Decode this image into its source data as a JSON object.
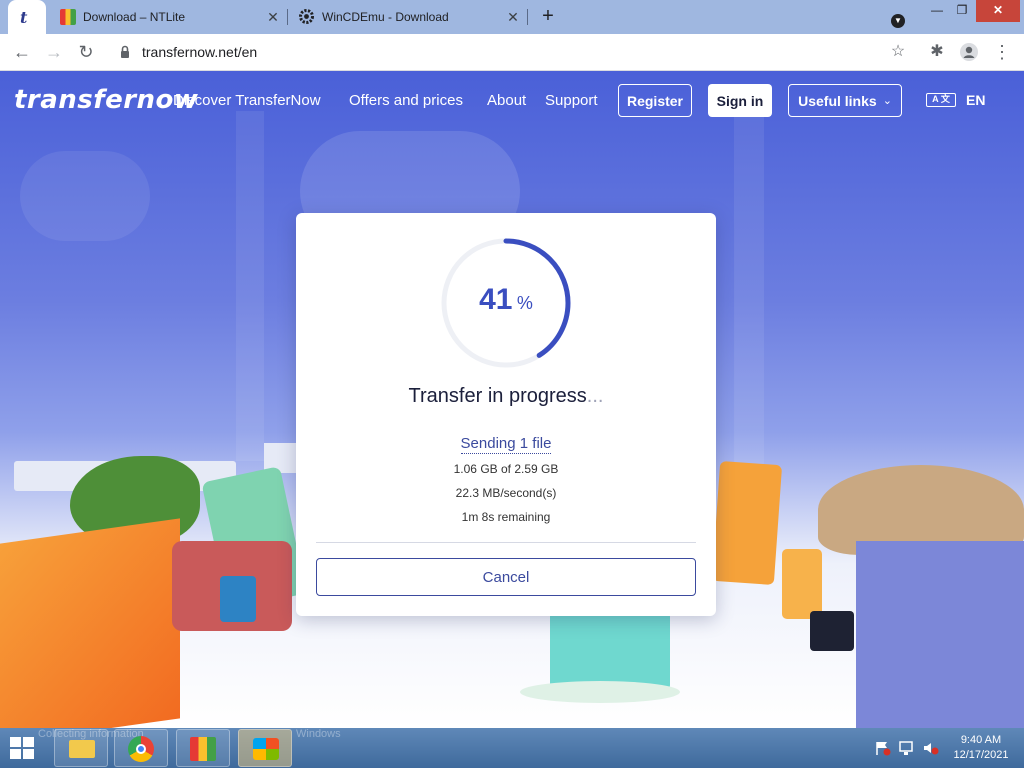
{
  "browser": {
    "tabs": [
      {
        "favicon": "tab-favicon-transfernow",
        "glyph": "t",
        "label": "",
        "active": true
      },
      {
        "favicon": "ntlite-icon",
        "label": "Download – NTLite",
        "active": false
      },
      {
        "favicon": "gear-icon",
        "label": "WinCDEmu - Download",
        "active": false
      }
    ],
    "tab_close_glyph": "✕",
    "new_tab_glyph": "+",
    "url": "transfernow.net/en",
    "window_controls": {
      "profile_glyph": "▼",
      "minimize": "—",
      "restore": "❐",
      "close": "✕"
    },
    "nav": {
      "back": "←",
      "forward": "→",
      "reload": "↻"
    },
    "toolbar": {
      "star": "☆",
      "extensions": "✱",
      "menu": "⋮"
    }
  },
  "site": {
    "logo": "transfernow",
    "nav_links": [
      "Discover TransferNow",
      "Offers and prices",
      "About",
      "Support"
    ],
    "register_label": "Register",
    "signin_label": "Sign in",
    "useful_links_label": "Useful links",
    "lang_icon_text": "A 文",
    "lang_code": "EN"
  },
  "transfer": {
    "percent": 41,
    "percent_unit": "%",
    "title": "Transfer in progress",
    "title_dots": "...",
    "sending": "Sending 1 file",
    "progress_text": "1.06 GB of 2.59 GB",
    "speed": "22.3 MB/second(s)",
    "remaining": "1m 8s remaining",
    "cancel_label": "Cancel",
    "accent_color": "#3a4ec0"
  },
  "taskbar": {
    "ghost_text": "Collecting information",
    "ghost_text_2": "Windows",
    "clock_time": "9:40 AM",
    "clock_date": "12/17/2021"
  }
}
